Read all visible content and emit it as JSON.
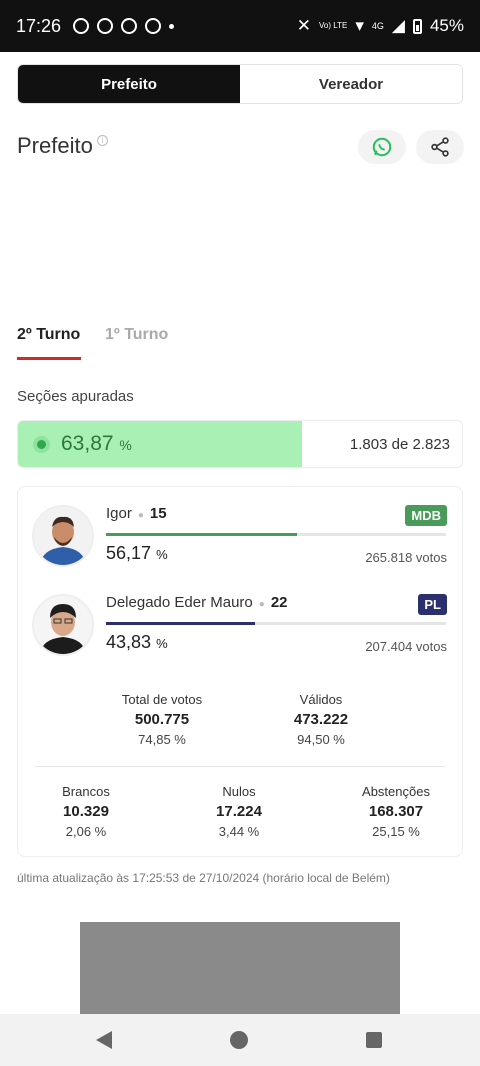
{
  "status_bar": {
    "time": "17:26",
    "network": "4G",
    "lte": "Vo) LTE",
    "battery": "45%"
  },
  "segmented": {
    "active_label": "Prefeito",
    "inactive_label": "Vereador"
  },
  "page": {
    "title": "Prefeito"
  },
  "rounds": {
    "active": "2º Turno",
    "inactive": "1º Turno"
  },
  "sections": {
    "label": "Seções apuradas",
    "percent": "63,87",
    "percent_unit": "%",
    "progress_fraction": 0.6387,
    "count": "1.803 de 2.823"
  },
  "candidates": [
    {
      "name": "Igor",
      "number": "15",
      "party": "MDB",
      "party_color": "#4a9a5a",
      "bar_color": "#4a9a5a",
      "share": 0.5617,
      "percent": "56,17",
      "unit": "%",
      "votes": "265.818 votos"
    },
    {
      "name": "Delegado Eder Mauro",
      "number": "22",
      "party": "PL",
      "party_color": "#2b2f6e",
      "bar_color": "#2b2f6e",
      "share": 0.4383,
      "percent": "43,83",
      "unit": "%",
      "votes": "207.404 votos"
    }
  ],
  "totals": {
    "total": {
      "label": "Total de votos",
      "value": "500.775",
      "pct": "74,85 %"
    },
    "validos": {
      "label": "Válidos",
      "value": "473.222",
      "pct": "94,50 %"
    },
    "brancos": {
      "label": "Brancos",
      "value": "10.329",
      "pct": "2,06 %"
    },
    "nulos": {
      "label": "Nulos",
      "value": "17.224",
      "pct": "3,44 %"
    },
    "abstencoes": {
      "label": "Abstenções",
      "value": "168.307",
      "pct": "25,15 %"
    }
  },
  "updated": "última atualização às 17:25:53 de 27/10/2024 (horário local de Belém)",
  "icons": [
    "whatsapp-icon",
    "share-icon",
    "info-icon",
    "back-icon",
    "home-icon",
    "recents-icon"
  ]
}
